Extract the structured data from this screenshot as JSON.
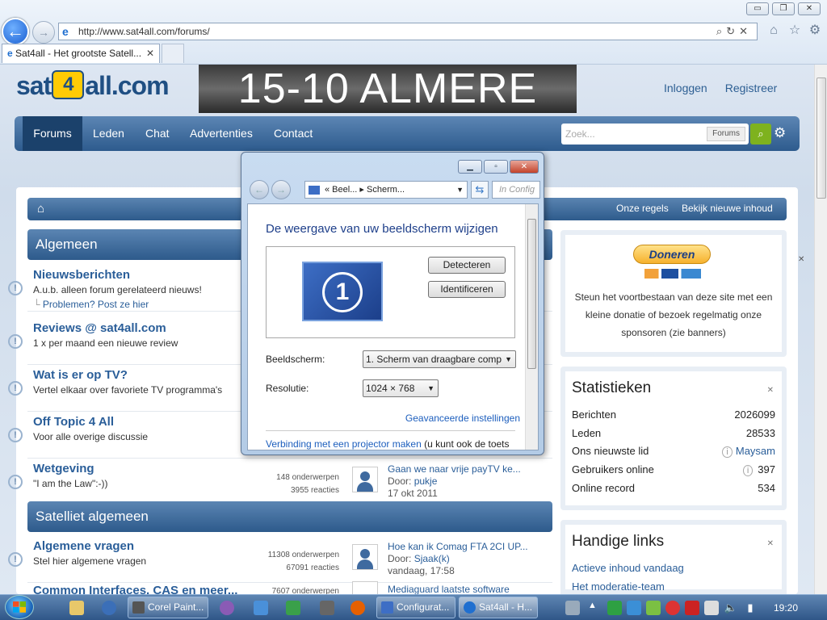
{
  "browser": {
    "url": "http://www.sat4all.com/forums/",
    "tab_title": "Sat4all - Het grootste Satell...",
    "tab_close": "✕",
    "win_min": "▭",
    "win_max": "❐",
    "win_close": "✕"
  },
  "site": {
    "logo_left": "sat",
    "logo_mid": "4",
    "logo_right": "all.com",
    "banner": "15-10 ALMERE",
    "login": "Inloggen",
    "register": "Registreer",
    "nav": [
      "Forums",
      "Leden",
      "Chat",
      "Advertenties",
      "Contact"
    ],
    "search_placeholder": "Zoek...",
    "search_scope": "Forums",
    "crumb_rules": "Onze regels",
    "crumb_new": "Bekijk nieuwe inhoud"
  },
  "categories": [
    {
      "title": "Algemeen"
    },
    {
      "title": "Satelliet algemeen"
    }
  ],
  "forums": [
    {
      "title": "Nieuwsberichten",
      "desc": "A.u.b. alleen forum gerelateerd nieuws!",
      "sub": "Problemen? Post ze hier"
    },
    {
      "title": "Reviews @ sat4all.com",
      "desc": "1 x per maand een nieuwe review"
    },
    {
      "title": "Wat is er op TV?",
      "desc": "Vertel elkaar over favoriete TV programma's"
    },
    {
      "title": "Off Topic 4 All",
      "desc": "Voor alle overige discussie"
    },
    {
      "title": "Wetgeving",
      "desc": "\"I am the Law\":-))",
      "topics": "148 onderwerpen",
      "replies": "3955 reacties",
      "last_title": "Gaan we naar vrije payTV ke...",
      "last_by": "Door:",
      "last_user": "pukje",
      "last_date": "17 okt 2011"
    },
    {
      "title": "Algemene vragen",
      "desc": "Stel hier algemene vragen",
      "topics": "11308 onderwerpen",
      "replies": "67091 reacties",
      "last_title": "Hoe kan ik Comag FTA 2CI UP...",
      "last_by": "Door:",
      "last_user": "Sjaak(k)",
      "last_date": "vandaag, 17:58"
    },
    {
      "title": "Common Interfaces, CAS en meer...",
      "topics": "7607 onderwerpen",
      "last_title": "Mediaguard laatste software"
    }
  ],
  "donate": {
    "button": "Doneren",
    "text": "Steun het voortbestaan van deze site met een kleine donatie of bezoek regelmatig onze sponsoren (zie banners)"
  },
  "stats": {
    "title": "Statistieken",
    "rows": [
      {
        "label": "Berichten",
        "value": "2026099"
      },
      {
        "label": "Leden",
        "value": "28533"
      },
      {
        "label": "Ons nieuwste lid",
        "value": "Maysam"
      },
      {
        "label": "Gebruikers online",
        "value": "397"
      },
      {
        "label": "Online record",
        "value": "534"
      }
    ]
  },
  "links": {
    "title": "Handige links",
    "items": [
      "Actieve inhoud vandaag",
      "Het moderatie-team"
    ]
  },
  "dialog": {
    "crumb": "« Beel...  ▸ Scherm...",
    "search": "In Config",
    "heading": "De weergave van uw beeldscherm wijzigen",
    "monitor_number": "1",
    "detect": "Detecteren",
    "identify": "Identificeren",
    "display_label": "Beeldscherm:",
    "display_value": "1. Scherm van draagbare comp",
    "resolution_label": "Resolutie:",
    "resolution_value": "1024 × 768",
    "advanced": "Geavanceerde instellingen",
    "projector_link": "Verbinding met een projector maken",
    "projector_rest": " (u kunt ook de toets"
  },
  "taskbar": {
    "tasks": [
      "Corel Paint...",
      "Configurat...",
      "Sat4all - H..."
    ],
    "clock": "19:20"
  },
  "colors": {
    "nav": "#2d5b8d",
    "link": "#2a5e99",
    "search_button": "#7eb21e"
  }
}
